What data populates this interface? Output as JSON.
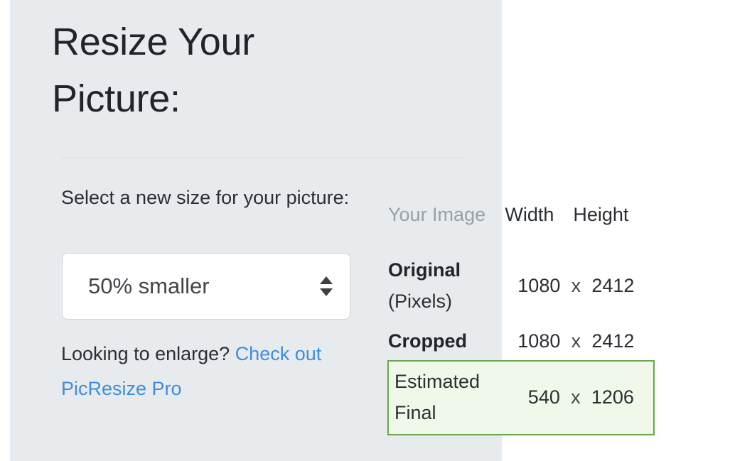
{
  "page": {
    "title": "Resize Your Picture:",
    "background_color": "#e8ebed",
    "accent_link_color": "#3f8ddd",
    "highlight_border_color": "#6aa84f",
    "highlight_fill_color": "#f0f8ea"
  },
  "form": {
    "label": "Select a new size for your picture:",
    "size_select": {
      "selected_value": "50% smaller",
      "stepper_icon": "select-stepper-arrows-icon"
    },
    "enlarge_prompt": "Looking to enlarge? ",
    "enlarge_link": "Check out PicResize Pro"
  },
  "size_table": {
    "header": {
      "label": "Your Image",
      "width": "Width",
      "height": "Height"
    },
    "rows": [
      {
        "label_main": "Original",
        "label_sub": "(Pixels)",
        "width": "1080",
        "separator": "x",
        "height": "2412",
        "highlighted": false
      },
      {
        "label_main": "Cropped",
        "label_sub": "",
        "width": "1080",
        "separator": "x",
        "height": "2412",
        "highlighted": false
      },
      {
        "label_main": "Estimated",
        "label_sub": "Final",
        "width": "540",
        "separator": "x",
        "height": "1206",
        "highlighted": true
      }
    ]
  }
}
